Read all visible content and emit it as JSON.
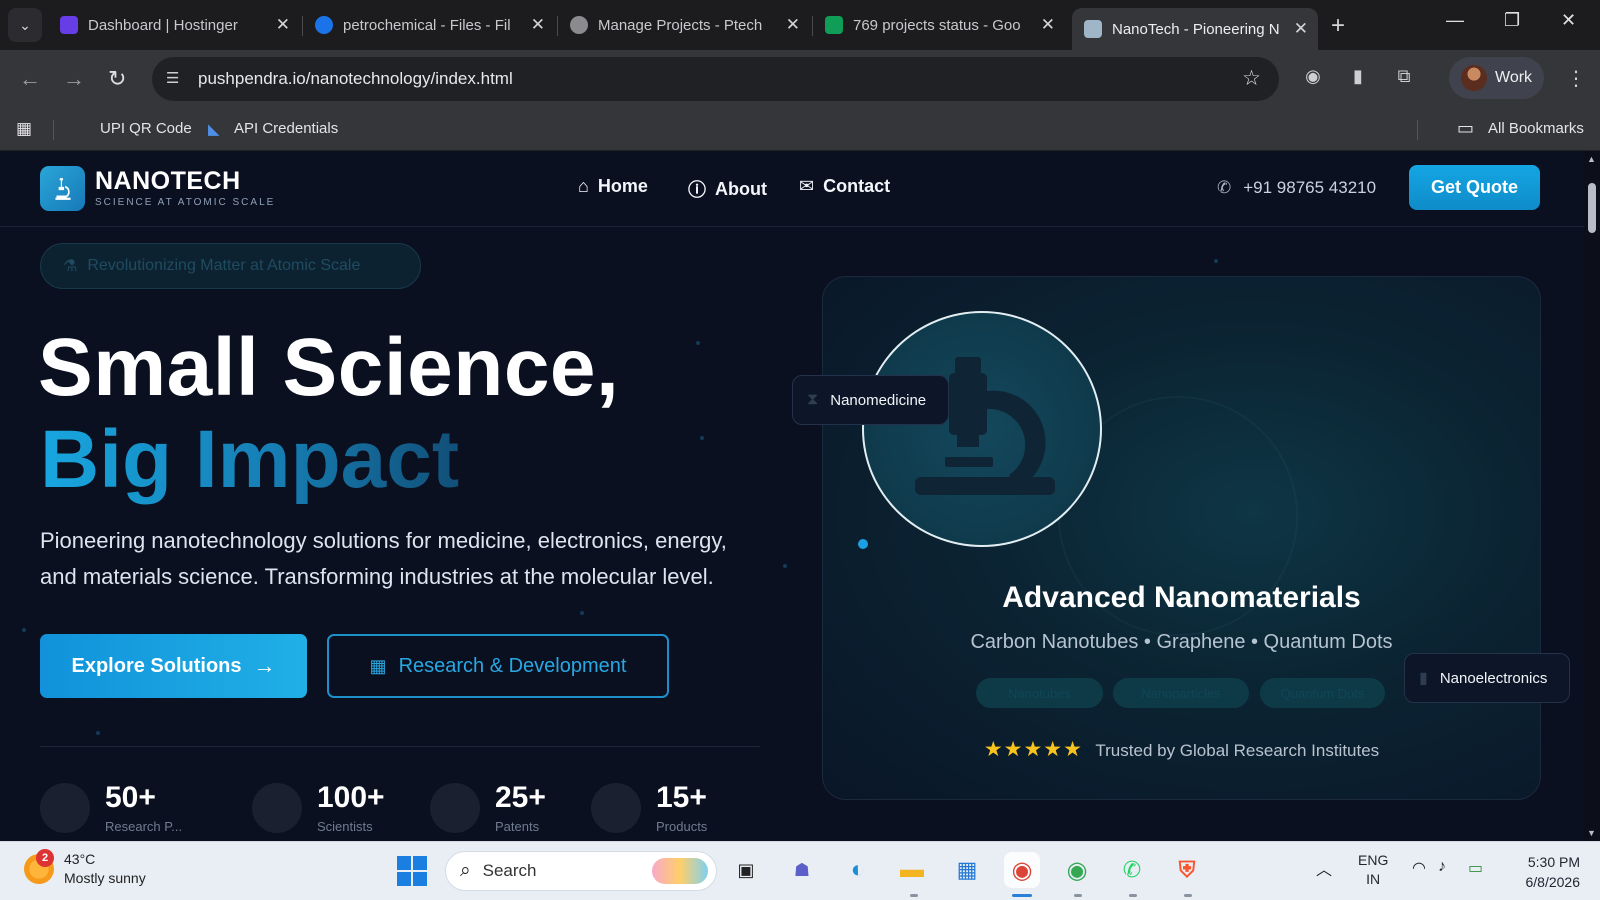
{
  "browser": {
    "tabs": [
      {
        "title": "Dashboard | Hostinger",
        "favicon_color": "#673de6"
      },
      {
        "title": "petrochemical - Files - Fil",
        "favicon_color": "#1a73e8"
      },
      {
        "title": "Manage Projects - Ptech",
        "favicon_color": "#8a8a8f"
      },
      {
        "title": "769 projects status - Goo",
        "favicon_color": "#0f9d58"
      },
      {
        "title": "NanoTech - Pioneering N",
        "favicon_color": "#9fb5c8",
        "active": true
      }
    ],
    "url": "pushpendra.io/nanotechnology/index.html",
    "profile_label": "Work",
    "bookmarks": [
      "UPI QR Code",
      "API Credentials"
    ],
    "all_bookmarks_label": "All Bookmarks"
  },
  "site": {
    "brand": "NANOTECH",
    "tagline": "SCIENCE AT ATOMIC SCALE",
    "nav": [
      {
        "label": "Home",
        "icon": "home-icon"
      },
      {
        "label": "About",
        "icon": "info-icon"
      },
      {
        "label": "Contact",
        "icon": "envelope-icon"
      }
    ],
    "phone": "+91 98765 43210",
    "cta": "Get Quote",
    "hero": {
      "badge": "Revolutionizing Matter at Atomic Scale",
      "title_line1": "Small Science,",
      "title_line2": "Big Impact",
      "lead": "Pioneering nanotechnology solutions for medicine, electronics, energy, and materials science. Transforming industries at the molecular level.",
      "primary_button": "Explore Solutions",
      "secondary_button": "Research & Development"
    },
    "stats": [
      {
        "value": "50+",
        "label": "Research P..."
      },
      {
        "value": "100+",
        "label": "Scientists"
      },
      {
        "value": "25+",
        "label": "Patents"
      },
      {
        "value": "15+",
        "label": "Products"
      }
    ],
    "card": {
      "chip_left": "Nanomedicine",
      "chip_right": "Nanoelectronics",
      "title": "Advanced Nanomaterials",
      "subtitle": "Carbon Nanotubes • Graphene • Quantum Dots",
      "tags": [
        "Nanotubes",
        "Nanoparticles",
        "Quantum Dots"
      ],
      "stars": "★★★★★",
      "rating_text": "Trusted by Global Research Institutes"
    },
    "colors": {
      "accent": "#14a6e4",
      "background": "#0b1020",
      "star": "#f8c31c"
    }
  },
  "taskbar": {
    "weather_temp": "43°C",
    "weather_desc": "Mostly sunny",
    "weather_badge": "2",
    "search_placeholder": "Search",
    "lang_line1": "ENG",
    "lang_line2": "IN",
    "time": "5:30 PM",
    "date": "6/8/2026"
  }
}
